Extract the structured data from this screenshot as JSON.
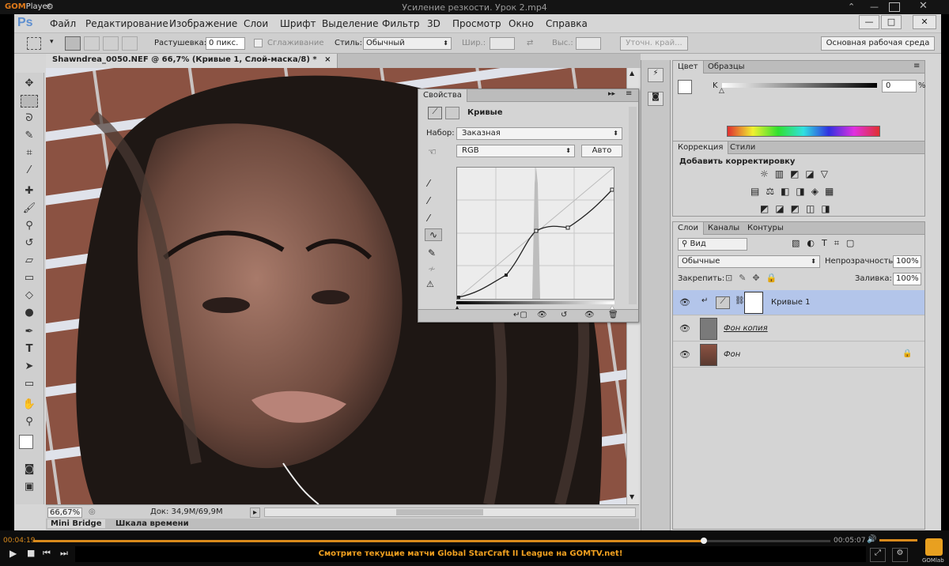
{
  "player": {
    "logo": "GOM",
    "logo_suffix": "Player",
    "settings_icon": "gear-icon",
    "window_title": "Усиление резкости. Урок 2.mp4",
    "win_buttons": [
      "pin-icon",
      "minimize-icon",
      "maximize-icon",
      "close-icon"
    ],
    "time_current": "00:04:19",
    "time_total": "00:05:07",
    "progress": 0.84,
    "ticker": "Смотрите текущие матчи Global StarCraft II League на GOMTV.net!",
    "brand_label": "GOMlab"
  },
  "photoshop": {
    "logo": "Ps",
    "menu": [
      "Файл",
      "Редактирование",
      "Изображение",
      "Слои",
      "Шрифт",
      "Выделение",
      "Фильтр",
      "3D",
      "Просмотр",
      "Окно",
      "Справка"
    ],
    "options": {
      "feather_label": "Растушевка:",
      "feather_value": "0 пикс.",
      "antialias_label": "Сглаживание",
      "style_label": "Стиль:",
      "style_value": "Обычный",
      "width_label": "Шир.:",
      "height_label": "Выс.:",
      "refine_button": "Уточн. край...",
      "workspace": "Основная рабочая среда"
    },
    "doc_tab": "Shawndrea_0050.NEF @ 66,7% (Кривые 1, Слой-маска/8) *",
    "doc_close": "×",
    "status": {
      "zoom": "66,67%",
      "doc_size": "Док: 34,9M/69,9M"
    },
    "bottom_tabs": [
      "Mini Bridge",
      "Шкала времени"
    ],
    "properties": {
      "tab": "Свойства",
      "title": "Кривые",
      "preset_label": "Набор:",
      "preset_value": "Заказная",
      "channel_value": "RGB",
      "auto_button": "Авто"
    },
    "color_panel": {
      "tabs": [
        "Цвет",
        "Образцы"
      ],
      "channel_label": "K",
      "value": "0",
      "unit": "%"
    },
    "adjustments_panel": {
      "tabs": [
        "Коррекция",
        "Стили"
      ],
      "title": "Добавить корректировку"
    },
    "layers_panel": {
      "tabs": [
        "Слои",
        "Каналы",
        "Контуры"
      ],
      "filter_value": "Вид",
      "blend_value": "Обычные",
      "opacity_label": "Непрозрачность:",
      "opacity_value": "100%",
      "lock_label": "Закрепить:",
      "fill_label": "Заливка:",
      "fill_value": "100%",
      "layers": [
        {
          "name": "Кривые 1",
          "selected": true
        },
        {
          "name": "Фон копия",
          "selected": false
        },
        {
          "name": "Фон",
          "selected": false
        }
      ]
    }
  }
}
